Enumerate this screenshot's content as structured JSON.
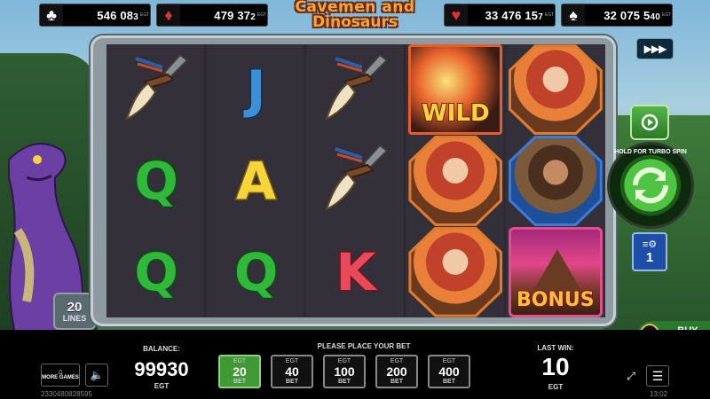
{
  "jackpots": [
    {
      "suit": "clubs",
      "symbol": "♣",
      "value_main": "546 08",
      "value_small": "3",
      "color": "#ffffff"
    },
    {
      "suit": "diamonds",
      "symbol": "♦",
      "value_main": "479 37",
      "value_small": "2",
      "color": "#e43232"
    },
    {
      "suit": "hearts",
      "symbol": "♥",
      "value_main": "33 476 15",
      "value_small": "7",
      "color": "#e43232"
    },
    {
      "suit": "spades",
      "symbol": "♠",
      "value_main": "32 075 5",
      "value_small": "40",
      "color": "#ffffff"
    }
  ],
  "jackpot_brand": "EGT",
  "logo": {
    "line1": "Cavemen and",
    "line2": "Dinosaurs"
  },
  "lines_badge": {
    "number": "20",
    "text": "LINES"
  },
  "reels": [
    [
      "tooth",
      "letter-q",
      "letter-q"
    ],
    [
      "letter-j",
      "letter-a",
      "letter-q"
    ],
    [
      "tooth",
      "tooth",
      "letter-k"
    ],
    [
      "wild",
      "cavewoman",
      "cavewoman"
    ],
    [
      "cavewoman",
      "caveman",
      "bonus"
    ]
  ],
  "symbol_text": {
    "q": "Q",
    "j": "J",
    "a": "A",
    "k": "K",
    "wild": "WILD",
    "bonus": "BONUS"
  },
  "controls": {
    "skip_icon": "▶▶▶",
    "autoplay_icon": "autoplay-icon",
    "spin_label": "HOLD FOR TURBO SPIN",
    "lines_value": "1",
    "buy_bonus": "BUY BONUS"
  },
  "bottom": {
    "more_games": "MORE GAMES",
    "balance_label": "BALANCE:",
    "balance": "99930",
    "balance_currency": "EGT",
    "bet_prompt": "PLEASE PLACE YOUR BET",
    "bets": [
      {
        "brand": "EGT",
        "amount": "20",
        "label": "BET",
        "selected": true
      },
      {
        "brand": "EGT",
        "amount": "40",
        "label": "BET",
        "selected": false
      },
      {
        "brand": "EGT",
        "amount": "100",
        "label": "BET",
        "selected": false
      },
      {
        "brand": "EGT",
        "amount": "200",
        "label": "BET",
        "selected": false
      },
      {
        "brand": "EGT",
        "amount": "400",
        "label": "BET",
        "selected": false
      }
    ],
    "last_win_label": "LAST WIN:",
    "last_win": "10",
    "last_win_currency": "EGT",
    "session_id": "2330480828595",
    "clock": "13:02"
  }
}
